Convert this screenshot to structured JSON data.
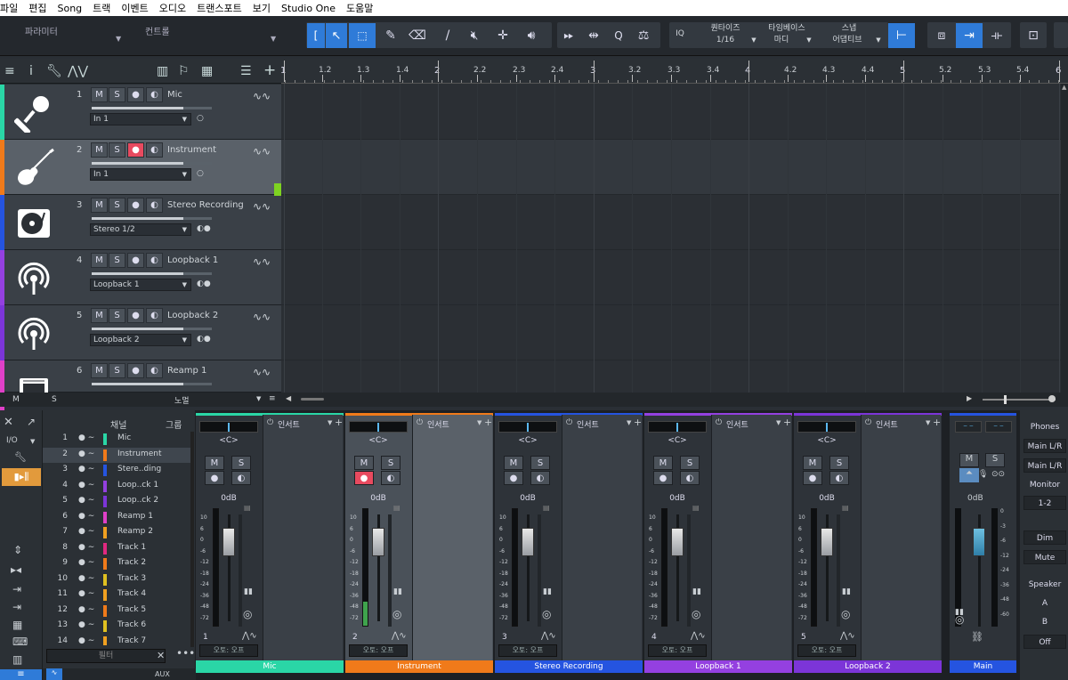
{
  "menu": [
    "파일",
    "편집",
    "Song",
    "트랙",
    "이벤트",
    "오디오",
    "트랜스포트",
    "보기",
    "Studio One",
    "도움말"
  ],
  "toolbar": {
    "parameters_label": "파라미터",
    "controls_label": "컨트롤",
    "iq_label": "IQ",
    "quantize": {
      "label": "퀀타이즈",
      "value": "1/16"
    },
    "timebase": {
      "label": "타임베이스",
      "value": "마디"
    },
    "snap": {
      "label": "스냅",
      "value": "어댑티브"
    }
  },
  "ruler": [
    "1",
    "1.2",
    "1.3",
    "1.4",
    "2",
    "2.2",
    "2.3",
    "2.4",
    "3",
    "3.2",
    "3.3",
    "3.4",
    "4",
    "4.2",
    "4.3",
    "4.4",
    "5",
    "5.2",
    "5.3",
    "5.4",
    "6"
  ],
  "tracks": [
    {
      "num": "1",
      "name": "Mic",
      "input": "In 1",
      "color": "#2ad6a6",
      "icon": "microphone-icon",
      "record_armed": false,
      "selected": false
    },
    {
      "num": "2",
      "name": "Instrument",
      "input": "In 1",
      "color": "#f07a1a",
      "icon": "guitar-icon",
      "record_armed": true,
      "selected": true
    },
    {
      "num": "3",
      "name": "Stereo Recording",
      "input": "Stereo 1/2",
      "color": "#2554e0",
      "icon": "turntable-icon",
      "record_armed": false,
      "selected": false
    },
    {
      "num": "4",
      "name": "Loopback 1",
      "input": "Loopback 1",
      "color": "#9440e0",
      "icon": "broadcast-icon",
      "record_armed": false,
      "selected": false
    },
    {
      "num": "5",
      "name": "Loopback 2",
      "input": "Loopback 2",
      "color": "#7c35d8",
      "icon": "broadcast-icon",
      "record_armed": false,
      "selected": false
    },
    {
      "num": "6",
      "name": "Reamp 1",
      "input": "",
      "color": "#e040c8",
      "icon": "amplifier-icon",
      "record_armed": false,
      "selected": false
    }
  ],
  "track_buttons": {
    "mute": "M",
    "solo": "S"
  },
  "track_footer": {
    "m": "M",
    "s": "S",
    "mode": "노멀"
  },
  "mixer": {
    "header": {
      "channel": "채널",
      "group": "그룹"
    },
    "io_label": "I/O",
    "channel_list": [
      {
        "num": "1",
        "name": "Mic",
        "color": "#2ad6a6"
      },
      {
        "num": "2",
        "name": "Instrument",
        "color": "#f07a1a"
      },
      {
        "num": "3",
        "name": "Stere..ding",
        "color": "#2554e0"
      },
      {
        "num": "4",
        "name": "Loop..ck 1",
        "color": "#9440e0"
      },
      {
        "num": "5",
        "name": "Loop..ck 2",
        "color": "#7c35d8"
      },
      {
        "num": "6",
        "name": "Reamp 1",
        "color": "#e040c8"
      },
      {
        "num": "7",
        "name": "Reamp 2",
        "color": "#f0a020"
      },
      {
        "num": "8",
        "name": "Track 1",
        "color": "#e02880"
      },
      {
        "num": "9",
        "name": "Track 2",
        "color": "#f07a1a"
      },
      {
        "num": "10",
        "name": "Track 3",
        "color": "#e0c020"
      },
      {
        "num": "11",
        "name": "Track 4",
        "color": "#f0a020"
      },
      {
        "num": "12",
        "name": "Track 5",
        "color": "#f07a1a"
      },
      {
        "num": "13",
        "name": "Track 6",
        "color": "#e0c020"
      },
      {
        "num": "14",
        "name": "Track 7",
        "color": "#f0a020"
      }
    ],
    "filter_placeholder": "필터",
    "bottom_tabs": [
      "AUX"
    ],
    "insert_label": "인서트",
    "pan_label": "<C>",
    "db_label": "0dB",
    "automation_label": "오토: 오프",
    "scale": [
      "10",
      "6",
      "0",
      "-6",
      "-12",
      "-18",
      "-24",
      "-36",
      "-48",
      "-72"
    ],
    "strips": [
      {
        "num": "1",
        "name": "Mic",
        "color": "#2ad6a6",
        "record_armed": false,
        "selected": false
      },
      {
        "num": "2",
        "name": "Instrument",
        "color": "#f07a1a",
        "record_armed": true,
        "selected": true
      },
      {
        "num": "3",
        "name": "Stereo Recording",
        "color": "#2554e0",
        "record_armed": false,
        "selected": false
      },
      {
        "num": "4",
        "name": "Loopback 1",
        "color": "#9440e0",
        "record_armed": false,
        "selected": false
      },
      {
        "num": "5",
        "name": "Loopback 2",
        "color": "#7c35d8",
        "record_armed": false,
        "selected": false
      }
    ],
    "main": {
      "name": "Main",
      "db": "0dB",
      "color": "#2554e0",
      "scale": [
        "0",
        "-3",
        "-6",
        "-12",
        "-24",
        "-36",
        "-48",
        "-60"
      ]
    },
    "right_panel": [
      "Phones",
      "Main L/R",
      "Main L/R",
      "Monitor",
      "1-2",
      "Dim",
      "Mute",
      "Speaker",
      "A",
      "B",
      "Off"
    ]
  }
}
